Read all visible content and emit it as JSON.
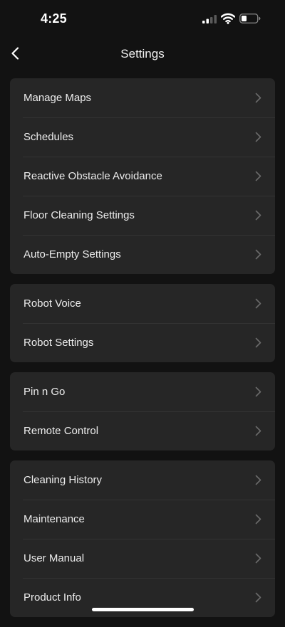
{
  "status_bar": {
    "time": "4:25"
  },
  "header": {
    "title": "Settings"
  },
  "groups": [
    {
      "items": [
        {
          "label": "Manage Maps"
        },
        {
          "label": "Schedules"
        },
        {
          "label": "Reactive Obstacle Avoidance"
        },
        {
          "label": "Floor Cleaning Settings"
        },
        {
          "label": "Auto-Empty Settings"
        }
      ]
    },
    {
      "items": [
        {
          "label": "Robot Voice"
        },
        {
          "label": "Robot Settings"
        }
      ]
    },
    {
      "items": [
        {
          "label": "Pin n Go"
        },
        {
          "label": "Remote Control"
        }
      ]
    },
    {
      "items": [
        {
          "label": "Cleaning History"
        },
        {
          "label": "Maintenance"
        },
        {
          "label": "User Manual"
        },
        {
          "label": "Product Info"
        }
      ]
    }
  ],
  "icons": {
    "back": "chevron-left-icon",
    "row_arrow": "chevron-right-icon",
    "signal": "cellular-signal-icon",
    "wifi": "wifi-icon",
    "battery": "battery-icon"
  },
  "colors": {
    "background": "#121212",
    "card": "#262626",
    "separator": "#333333",
    "text": "#ececec",
    "chevron": "#6a6a6a"
  }
}
